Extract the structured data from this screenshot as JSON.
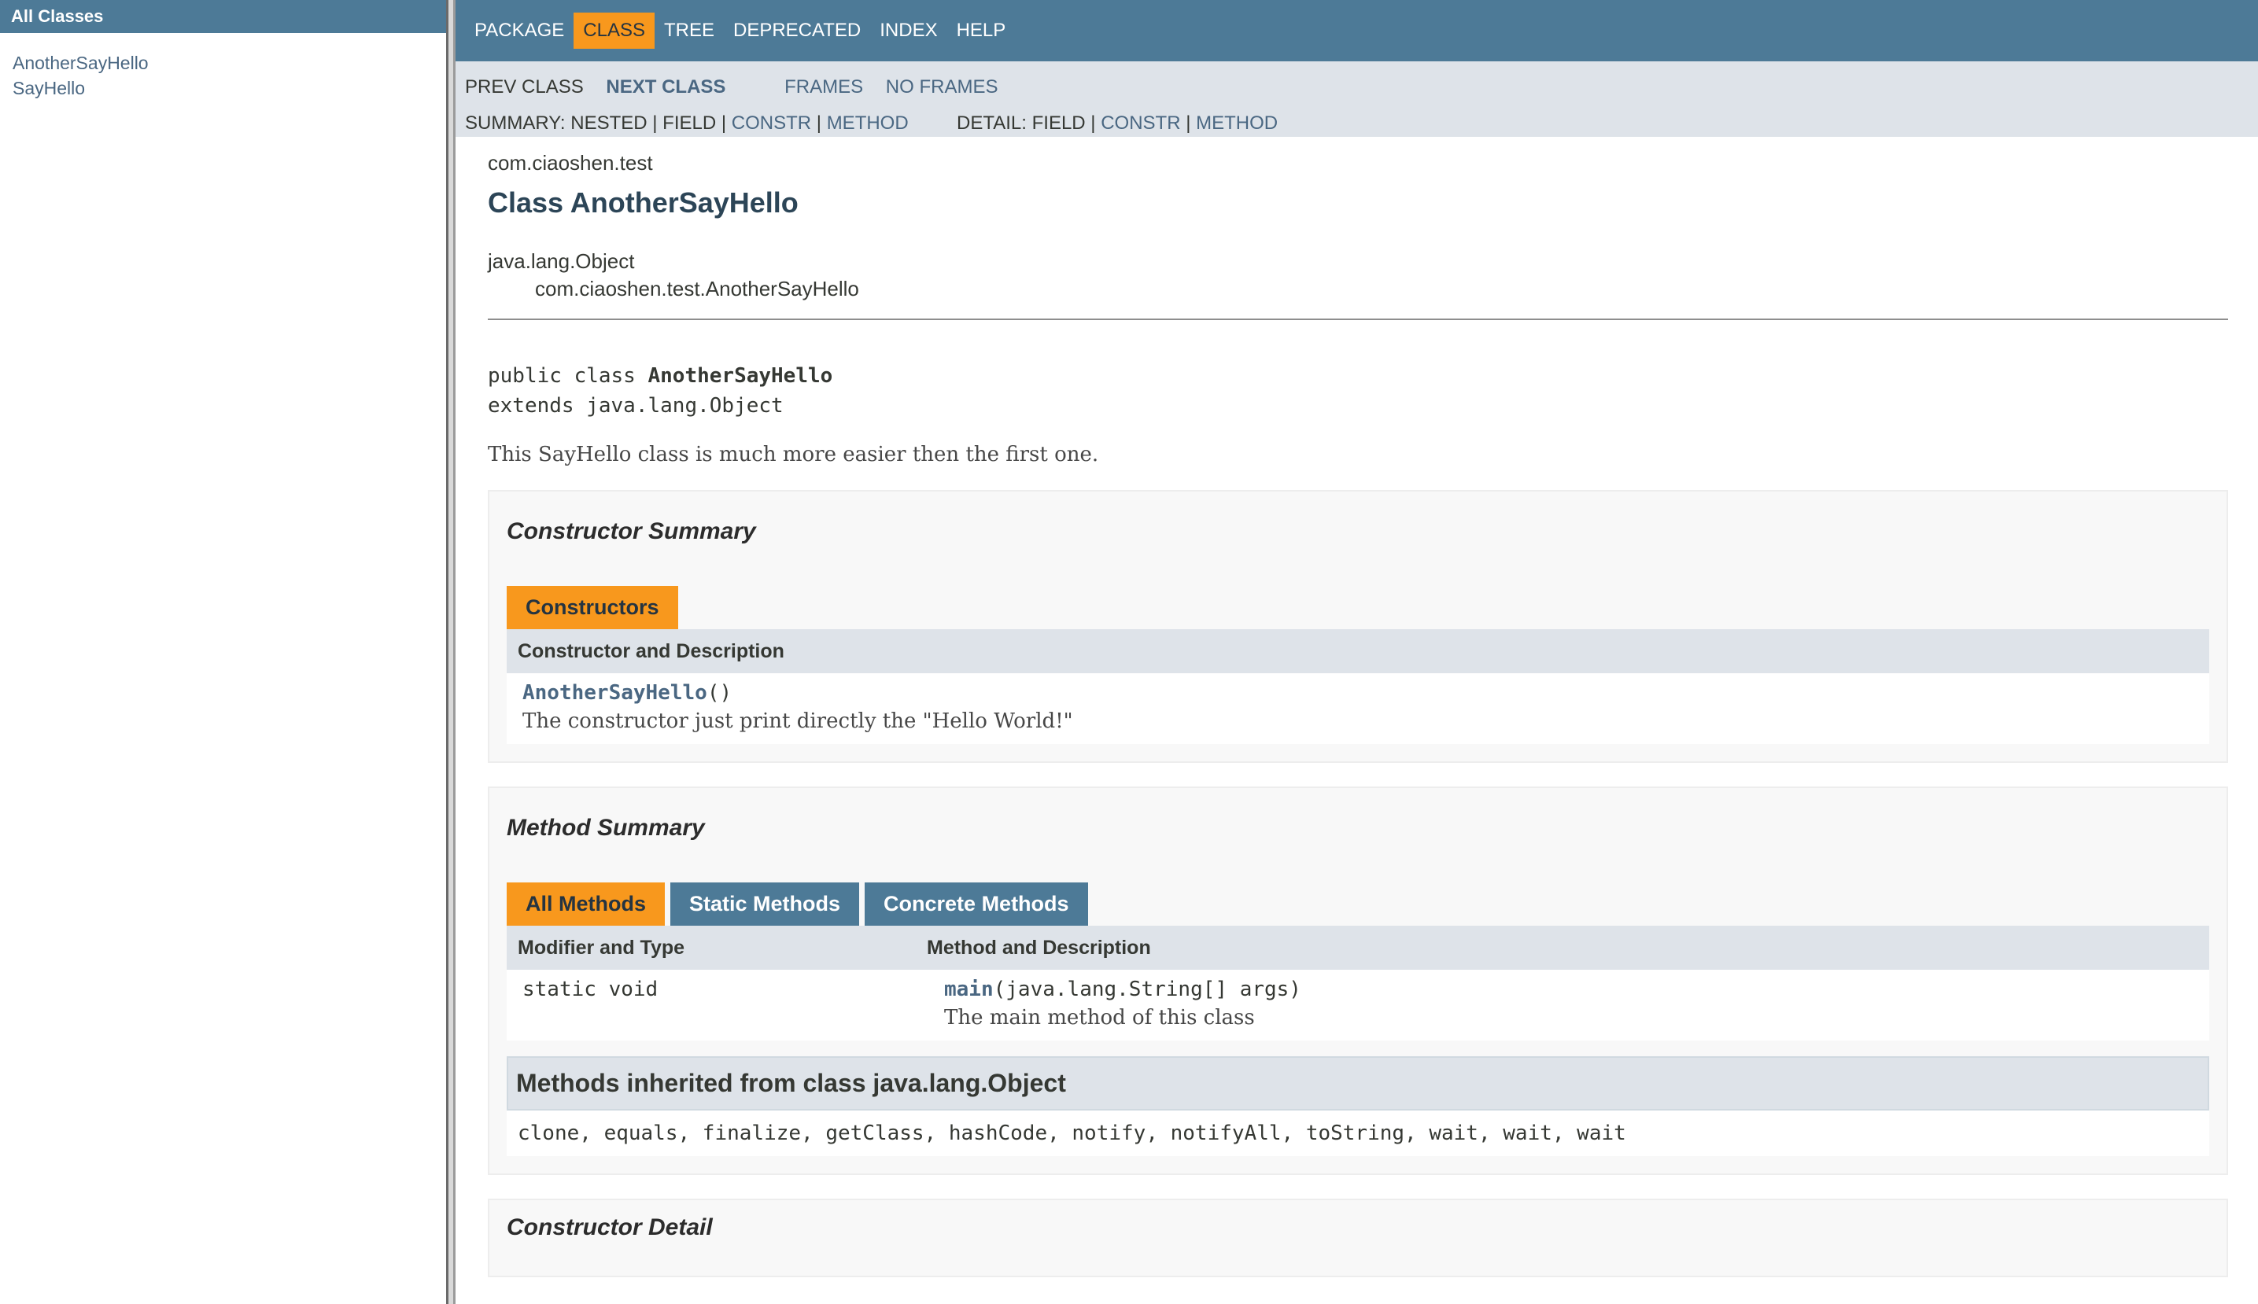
{
  "left": {
    "header": "All Classes",
    "classes": [
      "AnotherSayHello",
      "SayHello"
    ]
  },
  "topnav": [
    "PACKAGE",
    "CLASS",
    "TREE",
    "DEPRECATED",
    "INDEX",
    "HELP"
  ],
  "topnav_active": "CLASS",
  "subnav": {
    "prev_class": "PREV CLASS",
    "next_class": "NEXT CLASS",
    "frames": "FRAMES",
    "no_frames": "NO FRAMES",
    "summary_prefix": "SUMMARY: NESTED | FIELD |",
    "summary_constr": "CONSTR",
    "sep": "|",
    "summary_method": "METHOD",
    "detail_prefix": "DETAIL: FIELD |",
    "detail_constr": "CONSTR",
    "detail_method": "METHOD"
  },
  "header": {
    "package": "com.ciaoshen.test",
    "title": "Class AnotherSayHello",
    "inherit_parent": "java.lang.Object",
    "inherit_child": "com.ciaoshen.test.AnotherSayHello"
  },
  "signature": {
    "prefix": "public class ",
    "name": "AnotherSayHello",
    "extends": "extends java.lang.Object"
  },
  "description": "This SayHello class is much more easier then the first one.",
  "constructor_summary": {
    "title": "Constructor Summary",
    "tab": "Constructors",
    "column": "Constructor and Description",
    "name": "AnotherSayHello",
    "params": "()",
    "desc": "The constructor just print directly the \"Hello World!\""
  },
  "method_summary": {
    "title": "Method Summary",
    "tabs": [
      "All Methods",
      "Static Methods",
      "Concrete Methods"
    ],
    "columns": [
      "Modifier and Type",
      "Method and Description"
    ],
    "rows": [
      {
        "modifier": "static void",
        "name": "main",
        "params": "(java.lang.String[] args)",
        "desc": "The main method of this class"
      }
    ],
    "inherited_title": "Methods inherited from class java.lang.Object",
    "inherited_methods": "clone, equals, finalize, getClass, hashCode, notify, notifyAll, toString, wait, wait, wait"
  },
  "constructor_detail": {
    "title": "Constructor Detail"
  }
}
